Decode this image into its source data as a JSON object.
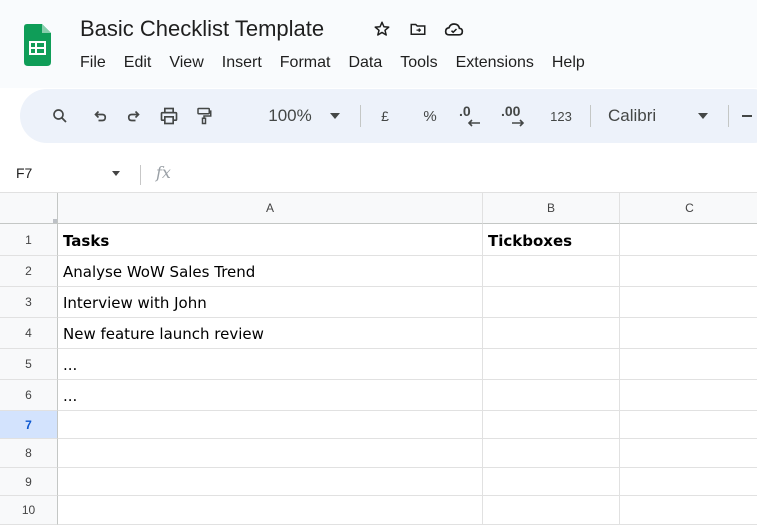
{
  "document": {
    "title": "Basic Checklist Template"
  },
  "menu": [
    "File",
    "Edit",
    "View",
    "Insert",
    "Format",
    "Data",
    "Tools",
    "Extensions",
    "Help"
  ],
  "toolbar": {
    "zoom": "100%",
    "currency_symbol": "£",
    "percent_symbol": "%",
    "decrease_decimal": ".0",
    "increase_decimal": ".00",
    "number_format": "123",
    "font": "Calibri"
  },
  "formula_bar": {
    "name_box": "F7",
    "function_symbol": "fx"
  },
  "sheet": {
    "columns": [
      "A",
      "B",
      "C"
    ],
    "rows": [
      "1",
      "2",
      "3",
      "4",
      "5",
      "6",
      "7",
      "8",
      "9",
      "10"
    ],
    "selected_row": "7",
    "cells": [
      [
        "Tasks",
        "Tickboxes",
        ""
      ],
      [
        "Analyse WoW Sales Trend",
        "",
        ""
      ],
      [
        "Interview with John",
        "",
        ""
      ],
      [
        "New feature launch review",
        "",
        ""
      ],
      [
        "...",
        "",
        ""
      ],
      [
        "...",
        "",
        ""
      ],
      [
        "",
        "",
        ""
      ],
      [
        "",
        "",
        ""
      ],
      [
        "",
        "",
        ""
      ],
      [
        "",
        "",
        ""
      ]
    ]
  },
  "colors": {
    "logo_green": "#0f9d58",
    "selection_blue": "#d3e3fd",
    "toolbar_bg": "#edf2fa"
  },
  "icons": [
    "sheets-logo",
    "star-icon",
    "move-to-folder-icon",
    "cloud-status-icon",
    "search-icon",
    "undo-icon",
    "redo-icon",
    "print-icon",
    "paint-format-icon",
    "chevron-down-icon"
  ]
}
